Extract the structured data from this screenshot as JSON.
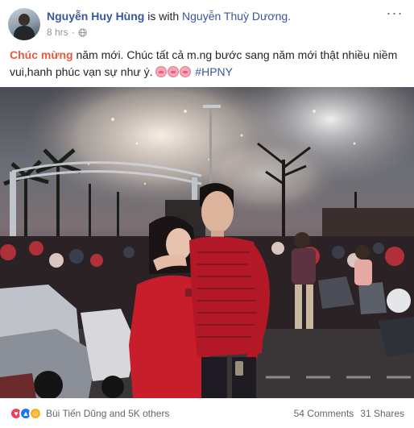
{
  "post": {
    "author": "Nguyễn Huy Hùng",
    "with_text": "is with",
    "tagged": "Nguyễn Thuỳ Dương.",
    "time": "8 hrs",
    "dot": "·",
    "more_label": "···",
    "text_highlight": "Chúc mừng",
    "text_body": " năm mới. Chúc tất cả m.ng bước sang năm mới thật nhiều niềm vui,hanh phúc vạn sự như ý.",
    "emoji_icon": "pig-face-icon",
    "hashtag": "#HPNY"
  },
  "footer": {
    "reaction_icons": [
      "love-icon",
      "like-icon",
      "haha-icon"
    ],
    "reaction_names": "Bùi Tiến Dũng and 5K others",
    "comments": "54 Comments",
    "shares": "31 Shares"
  },
  "colors": {
    "link": "#365899",
    "highlight": "#e9573f",
    "meta": "#90949c"
  }
}
